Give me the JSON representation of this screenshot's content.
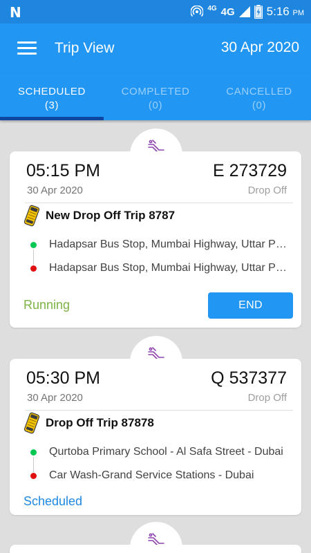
{
  "status_bar": {
    "network_small": "4G",
    "network": "4G",
    "time": "5:16",
    "ampm": "PM"
  },
  "app_bar": {
    "title": "Trip View",
    "date": "30 Apr 2020"
  },
  "tabs": [
    {
      "label": "SCHEDULED",
      "count": "(3)",
      "active": true
    },
    {
      "label": "COMPLETED",
      "count": "(0)",
      "active": false
    },
    {
      "label": "CANCELLED",
      "count": "(0)",
      "active": false
    }
  ],
  "trips": [
    {
      "time": "05:15 PM",
      "code": "E 273729",
      "date": "30 Apr 2020",
      "type": "Drop Off",
      "name": "New Drop Off Trip 8787",
      "stops": [
        "Hadapsar Bus Stop, Mumbai Highway, Uttar Pradesh",
        "Hadapsar Bus Stop, Mumbai Highway, Uttar Pradesh"
      ],
      "status": "Running",
      "action_label": "END"
    },
    {
      "time": "05:30 PM",
      "code": "Q 537377",
      "date": "30 Apr 2020",
      "type": "Drop Off",
      "name": "Drop Off Trip 87878",
      "stops": [
        "Qurtoba Primary School - Al Safa Street - Dubai",
        "Car Wash-Grand Service Stations - Dubai"
      ],
      "status": "Scheduled"
    }
  ],
  "colors": {
    "primary": "#2196f3",
    "status_bar": "#1f86e0",
    "tab_indicator": "#0d47a1",
    "running": "#7cb342",
    "scheduled": "#1e88e5",
    "stop_start": "#00c853",
    "stop_end": "#e01010",
    "trip_icon": "#8e44ad"
  },
  "icons": {
    "menu": "hamburger-menu-icon",
    "trip_type": "drop-off-trip-icon",
    "vehicle": "bus-icon"
  }
}
